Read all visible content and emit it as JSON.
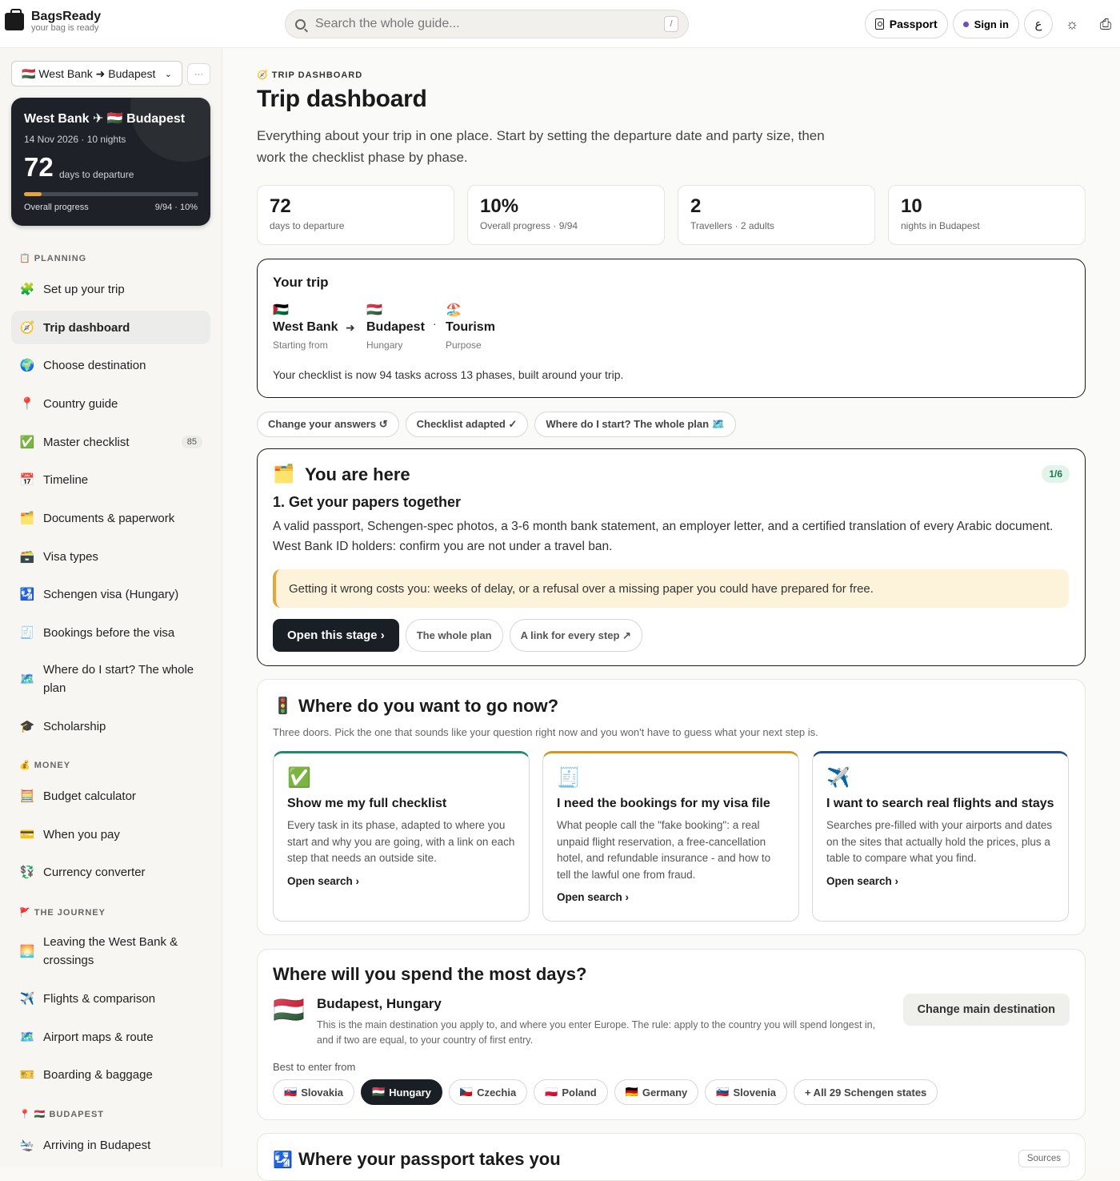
{
  "header": {
    "brand": "BagsReady",
    "tagline": "your bag is ready",
    "search_placeholder": "Search the whole guide...",
    "search_shortcut": "/",
    "passport_label": "Passport",
    "signin_label": "Sign in",
    "lang_label": "ع"
  },
  "sidebar": {
    "trip_selector": "🇭🇺 West Bank ➜ Budapest",
    "more_label": "···",
    "trip_card": {
      "title": "West Bank ✈ 🇭🇺 Budapest",
      "dates": "14 Nov 2026 · 10 nights",
      "days": "72",
      "days_label": "days to departure",
      "progress_label": "Overall progress",
      "progress_value": "9/94 · 10%",
      "progress_fraction": 0.1
    },
    "sections": [
      {
        "label": "📋 PLANNING"
      },
      {
        "label": "💰 MONEY"
      },
      {
        "label": "🚩 THE JOURNEY"
      },
      {
        "label": "📍 🇭🇺 BUDAPEST"
      }
    ],
    "items": [
      {
        "icon": "🧩",
        "label": "Set up your trip"
      },
      {
        "icon": "🧭",
        "label": "Trip dashboard"
      },
      {
        "icon": "🌍",
        "label": "Choose destination"
      },
      {
        "icon": "📍",
        "label": "Country guide"
      },
      {
        "icon": "✅",
        "label": "Master checklist",
        "badge": "85"
      },
      {
        "icon": "📅",
        "label": "Timeline"
      },
      {
        "icon": "🗂️",
        "label": "Documents & paperwork"
      },
      {
        "icon": "🗃️",
        "label": "Visa types"
      },
      {
        "icon": "🛂",
        "label": "Schengen visa (Hungary)"
      },
      {
        "icon": "🧾",
        "label": "Bookings before the visa"
      },
      {
        "icon": "🗺️",
        "label": "Where do I start? The whole plan"
      },
      {
        "icon": "🎓",
        "label": "Scholarship"
      },
      {
        "icon": "🧮",
        "label": "Budget calculator"
      },
      {
        "icon": "💳",
        "label": "When you pay"
      },
      {
        "icon": "💱",
        "label": "Currency converter"
      },
      {
        "icon": "🌅",
        "label": "Leaving the West Bank & crossings"
      },
      {
        "icon": "✈️",
        "label": "Flights & comparison"
      },
      {
        "icon": "🗺️",
        "label": "Airport maps & route"
      },
      {
        "icon": "🎫",
        "label": "Boarding & baggage"
      },
      {
        "icon": "🛬",
        "label": "Arriving in Budapest"
      }
    ]
  },
  "main": {
    "eyebrow": "🧭 TRIP DASHBOARD",
    "title": "Trip dashboard",
    "subtitle": "Everything about your trip in one place. Start by setting the departure date and party size, then work the checklist phase by phase.",
    "stats": [
      {
        "value": "72",
        "label": "days to departure"
      },
      {
        "value": "10%",
        "label": "Overall progress · 9/94"
      },
      {
        "value": "2",
        "label": "Travellers · 2 adults"
      },
      {
        "value": "10",
        "label": "nights in Budapest"
      }
    ],
    "your_trip": {
      "title": "Your trip",
      "origin_flag": "🇵🇸",
      "origin": "West Bank",
      "origin_label": "Starting from",
      "arrow": "➜",
      "dest_flag": "🇭🇺",
      "dest": "Budapest",
      "dest_label": "Hungary",
      "sep": "·",
      "purpose_icon": "🏖️",
      "purpose": "Tourism",
      "purpose_label": "Purpose",
      "note": "Your checklist is now 94 tasks across 13 phases, built around your trip."
    },
    "chips": [
      "Change your answers ↺",
      "Checklist adapted ✓",
      "Where do I start? The whole plan 🗺️"
    ],
    "here": {
      "icon": "🗂️",
      "title": "You are here",
      "badge": "1/6",
      "step": "1. Get your papers together",
      "desc": "A valid passport, Schengen-spec photos, a 3-6 month bank statement, an employer letter, and a certified translation of every Arabic document. West Bank ID holders: confirm you are not under a travel ban.",
      "warning": "Getting it wrong costs you: weeks of delay, or a refusal over a missing paper you could have prepared for free.",
      "primary": "Open this stage ›",
      "secondary": "The whole plan",
      "tertiary": "A link for every step ↗"
    },
    "where_now": {
      "icon": "🚦",
      "title": "Where do you want to go now?",
      "sub": "Three doors. Pick the one that sounds like your question right now and you won't have to guess what your next step is.",
      "doors": [
        {
          "icon": "✅",
          "title": "Show me my full checklist",
          "desc": "Every task in its phase, adapted to where you start and why you are going, with a link on each step that needs an outside site.",
          "link": "Open search ›",
          "color": "#1e8a6e"
        },
        {
          "icon": "🧾",
          "title": "I need the bookings for my visa file",
          "desc": "What people call the \"fake booking\": a real unpaid flight reservation, a free-cancellation hotel, and refundable insurance - and how to tell the lawful one from fraud.",
          "link": "Open search ›",
          "color": "#d19a1c"
        },
        {
          "icon": "✈️",
          "title": "I want to search real flights and stays",
          "desc": "Searches pre-filled with your airports and dates on the sites that actually hold the prices, plus a table to compare what you find.",
          "link": "Open search ›",
          "color": "#1f4f8a"
        }
      ]
    },
    "spend": {
      "title": "Where will you spend the most days?",
      "flag": "🇭🇺",
      "city": "Budapest, Hungary",
      "desc": "This is the main destination you apply to, and where you enter Europe. The rule: apply to the country you will spend longest in, and if two are equal, to your country of first entry.",
      "button": "Change main destination",
      "best_label": "Best to enter from",
      "countries": [
        {
          "flag": "🇸🇰",
          "name": "Slovakia",
          "selected": false
        },
        {
          "flag": "🇭🇺",
          "name": "Hungary",
          "selected": true
        },
        {
          "flag": "🇨🇿",
          "name": "Czechia",
          "selected": false
        },
        {
          "flag": "🇵🇱",
          "name": "Poland",
          "selected": false
        },
        {
          "flag": "🇩🇪",
          "name": "Germany",
          "selected": false
        },
        {
          "flag": "🇸🇮",
          "name": "Slovenia",
          "selected": false
        }
      ],
      "all_states": "+ All 29 Schengen states"
    },
    "passport": {
      "icon": "🛂",
      "title": "Where your passport takes you",
      "sources": "Sources"
    }
  }
}
